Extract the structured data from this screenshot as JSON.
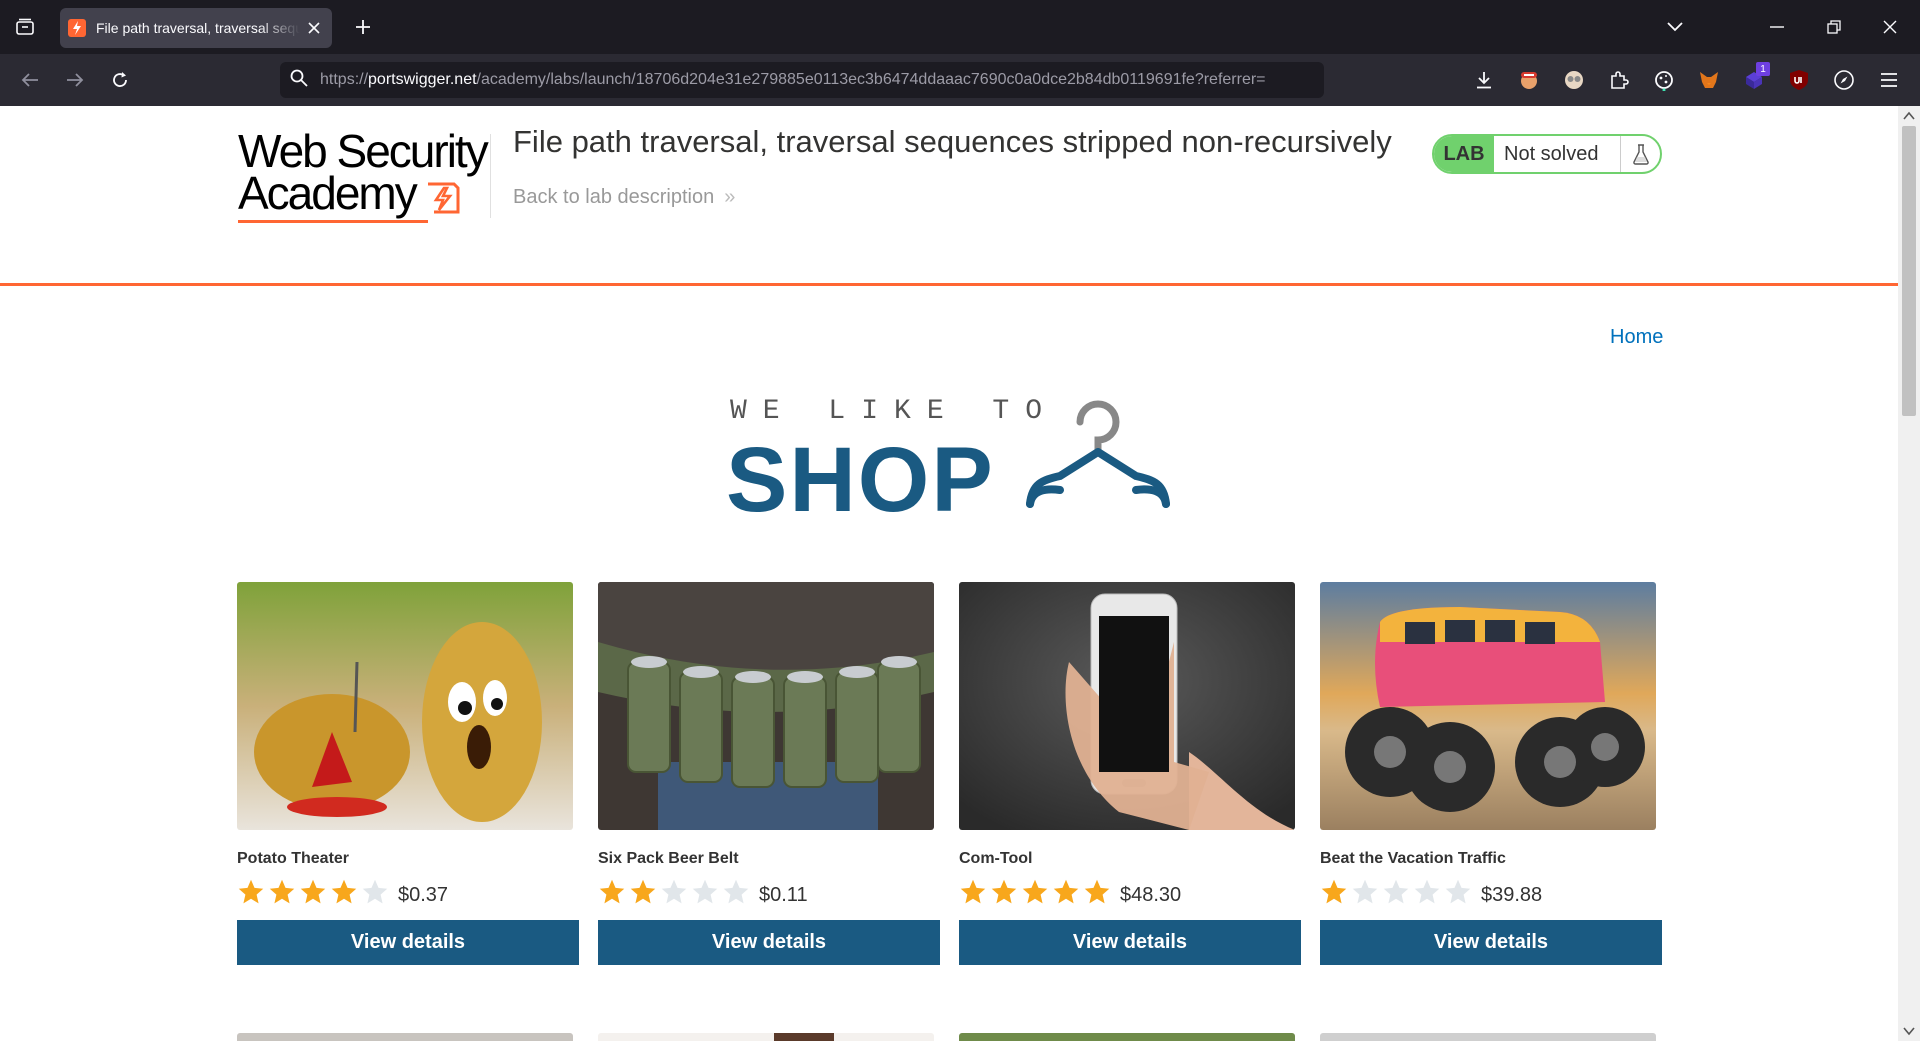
{
  "browser": {
    "tab_title": "File path traversal, traversal sequences stripped non-recursively",
    "url_prefix": "https://",
    "url_host": "portswigger.net",
    "url_path": "/academy/labs/launch/18706d204e31e279885e0113ec3b6474ddaaac7690c0a0dce2b84db0119691fe?referrer=",
    "extension_badge": "1",
    "colors": {
      "tabbar": "#1c1b22",
      "navbar": "#2b2a33",
      "active_tab": "#42414d"
    }
  },
  "header": {
    "logo_line1": "Web Security",
    "logo_line2": "Academy",
    "lab_title": "File path traversal, traversal sequences stripped non-recursively",
    "back_link": "Back to lab description",
    "back_chevron": "»",
    "lab_badge": "LAB",
    "lab_status": "Not solved",
    "accent_color": "#ff6633",
    "status_color": "#70d16d"
  },
  "nav": {
    "home_link": "Home"
  },
  "hero": {
    "small_text": "WE LIKE TO",
    "big_text": "SHOP",
    "color": "#1a5a82"
  },
  "products": [
    {
      "name": "Potato Theater",
      "rating": 4,
      "price": "$0.37",
      "button": "View details",
      "image": "potato-theater-image"
    },
    {
      "name": "Six Pack Beer Belt",
      "rating": 2,
      "price": "$0.11",
      "button": "View details",
      "image": "beer-belt-image"
    },
    {
      "name": "Com-Tool",
      "rating": 5,
      "price": "$48.30",
      "button": "View details",
      "image": "smartphone-image"
    },
    {
      "name": "Beat the Vacation Traffic",
      "rating": 1,
      "price": "$39.88",
      "button": "View details",
      "image": "monster-van-image"
    }
  ],
  "button_color": "#1a5a82",
  "star_on_color": "#f8a71c",
  "star_off_color": "#e1e6ea"
}
